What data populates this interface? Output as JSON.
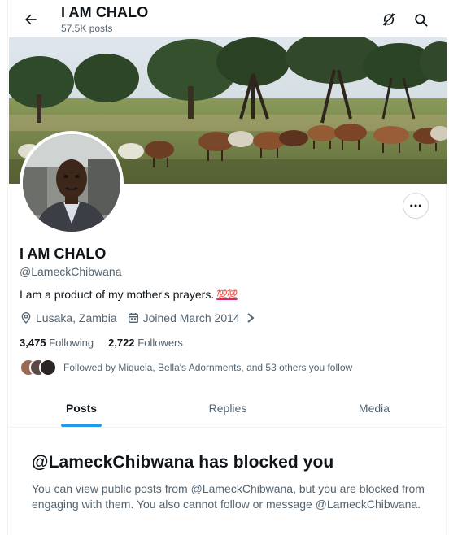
{
  "header": {
    "title": "I AM CHALO",
    "post_count": "57.5K posts"
  },
  "profile": {
    "name": "I AM CHALO",
    "handle": "@LameckChibwana",
    "bio": "I am a product of my mother's prayers.",
    "bio_emoji": "💯💯",
    "location": "Lusaka, Zambia",
    "joined": "Joined March 2014",
    "following_count": "3,475",
    "following_label": "Following",
    "followers_count": "2,722",
    "followers_label": "Followers",
    "followed_by": "Followed by Miquela, Bella's Adornments, and 53 others you follow"
  },
  "tabs": [
    {
      "label": "Posts",
      "active": true
    },
    {
      "label": "Replies",
      "active": false
    },
    {
      "label": "Media",
      "active": false
    }
  ],
  "blocked": {
    "title": "@LameckChibwana has blocked you",
    "message": "You can view public posts from @LameckChibwana, but you are blocked from engaging with them. You also cannot follow or message @LameckChibwana."
  },
  "icons": {
    "back": "arrow-left-icon",
    "notifications_off": "notifications-off-icon",
    "search": "search-icon",
    "more": "more-icon",
    "location": "location-pin-icon",
    "calendar": "calendar-icon",
    "chevron": "chevron-right-icon"
  },
  "colors": {
    "accent": "#1d9bf0",
    "text_primary": "#0f1419",
    "text_secondary": "#536471",
    "emoji_red": "#e0245e"
  }
}
